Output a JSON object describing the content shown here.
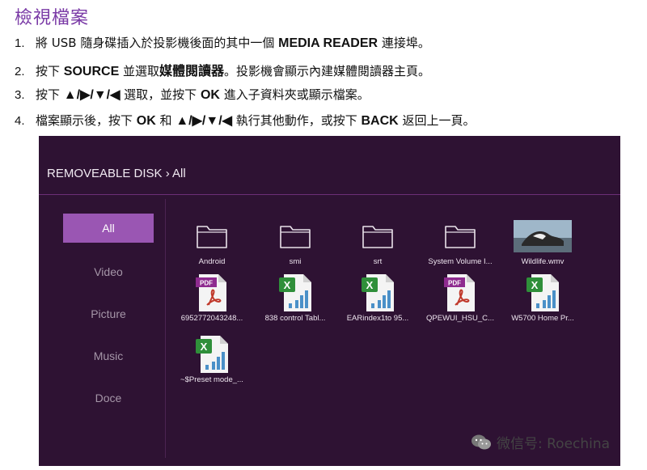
{
  "doc": {
    "title": "檢視檔案",
    "steps": [
      {
        "num": "1.",
        "parts": [
          {
            "t": "將 USB 隨身碟插入於投影機後面的其中一個 "
          },
          {
            "t": "MEDIA READER",
            "b": true
          },
          {
            "t": " 連接埠。"
          }
        ]
      },
      {
        "num": "2.",
        "parts": [
          {
            "t": "按下 "
          },
          {
            "t": "SOURCE",
            "b": true
          },
          {
            "t": " 並選取"
          },
          {
            "t": "媒體閱讀器",
            "b": true
          },
          {
            "t": "。投影機會顯示內建媒體閱讀器主頁。"
          }
        ]
      },
      {
        "num": "3.",
        "parts": [
          {
            "t": "按下 "
          },
          {
            "t": "▲/▶/▼/◀",
            "b": true
          },
          {
            "t": " 選取，並按下 "
          },
          {
            "t": "OK",
            "b": true
          },
          {
            "t": " 進入子資料夾或顯示檔案。"
          }
        ]
      },
      {
        "num": "4.",
        "parts": [
          {
            "t": "檔案顯示後，按下 "
          },
          {
            "t": "OK",
            "b": true
          },
          {
            "t": " 和 "
          },
          {
            "t": "▲/▶/▼/◀",
            "b": true
          },
          {
            "t": " 執行其他動作，或按下 "
          },
          {
            "t": "BACK",
            "b": true
          },
          {
            "t": " 返回上一頁。"
          }
        ]
      }
    ]
  },
  "screen": {
    "breadcrumb": "REMOVEABLE DISK › All",
    "sidebar": [
      "All",
      "Video",
      "Picture",
      "Music",
      "Doce"
    ],
    "active_index": 0,
    "files": [
      {
        "name": "Android",
        "type": "folder"
      },
      {
        "name": "smi",
        "type": "folder"
      },
      {
        "name": "srt",
        "type": "folder"
      },
      {
        "name": "System Volume I...",
        "type": "folder"
      },
      {
        "name": "Wildlife.wmv",
        "type": "video"
      },
      {
        "name": "6952772043248...",
        "type": "pdf"
      },
      {
        "name": "838 control Tabl...",
        "type": "excel"
      },
      {
        "name": "EARindex1to 95...",
        "type": "excel"
      },
      {
        "name": "QPEWUI_HSU_C...",
        "type": "pdf"
      },
      {
        "name": "W5700 Home Pr...",
        "type": "excel"
      },
      {
        "name": "~$Preset mode_...",
        "type": "excel"
      }
    ],
    "pdf_label": "PDF"
  },
  "watermark": "微信号: Roechina",
  "colors": {
    "screen_bg": "#2e1233",
    "accent": "#9a56b3",
    "title": "#7a3aa6"
  }
}
